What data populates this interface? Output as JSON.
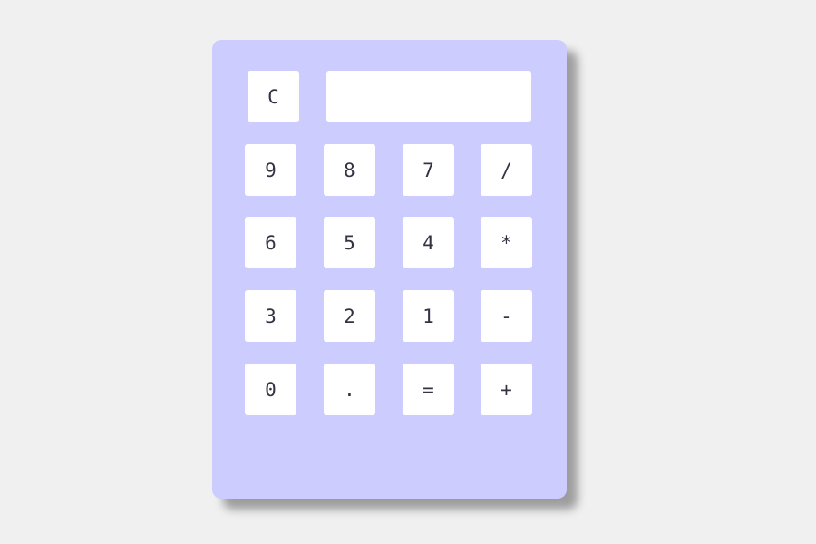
{
  "calculator": {
    "display_value": "",
    "clear_label": "C",
    "keys": {
      "nine": "9",
      "eight": "8",
      "seven": "7",
      "divide": "/",
      "six": "6",
      "five": "5",
      "four": "4",
      "multiply": "*",
      "three": "3",
      "two": "2",
      "one": "1",
      "subtract": "-",
      "zero": "0",
      "decimal": ".",
      "equals": "=",
      "add": "+"
    }
  },
  "colors": {
    "page_background": "#f0f0f0",
    "calculator_body": "#ccccff",
    "key_background": "#ffffff"
  }
}
